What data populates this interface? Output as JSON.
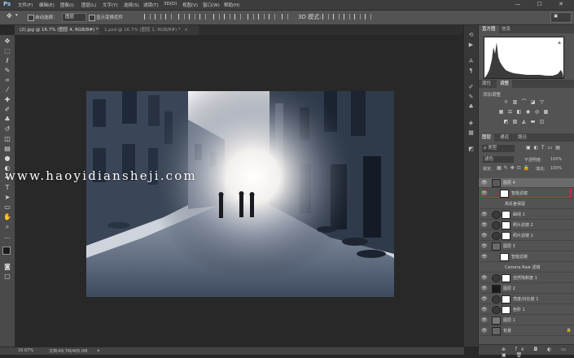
{
  "app": {
    "logo": "Ps"
  },
  "menu": [
    {
      "label": "文件(F)"
    },
    {
      "label": "编辑(E)"
    },
    {
      "label": "图像(I)"
    },
    {
      "label": "图层(L)"
    },
    {
      "label": "文字(Y)"
    },
    {
      "label": "选择(S)"
    },
    {
      "label": "滤镜(T)"
    },
    {
      "label": "3D(D)"
    },
    {
      "label": "视图(V)"
    },
    {
      "label": "窗口(W)"
    },
    {
      "label": "帮助(H)"
    }
  ],
  "window_controls": "— ☐ ✕",
  "options": {
    "auto_select_label": "自动选择：",
    "auto_select_target": "图层",
    "show_transform_label": "显示变换控件"
  },
  "documents": [
    {
      "title": "(2).jpg @ 16.7% (图层 4, RGB/8#) *"
    },
    {
      "title": "1.psd @ 16.7% (图层 1, RGB/8#) *"
    }
  ],
  "status": {
    "zoom": "16.67%",
    "doc_info": "文档:49.7M/405.0M"
  },
  "watermark": "www.haoyidiansheji.com",
  "panels": {
    "histogram_tabs": [
      "直方图",
      "信息"
    ],
    "props_tabs": [
      "属性",
      "调整"
    ],
    "adjust_label": "添加调整",
    "layers_tabs": [
      "图层",
      "通道",
      "路径"
    ],
    "layer_filter": "ρ 类型",
    "blend_mode": "滤色",
    "opacity_label": "不透明度:",
    "opacity_value": "100%",
    "lock_label": "锁定:",
    "fill_label": "填充:",
    "fill_value": "100%"
  },
  "layers": [
    {
      "name": "图层 4",
      "thumb": "#5a5a5a",
      "selected": true
    },
    {
      "name": "智能滤镜",
      "thumb": "#ffffff",
      "indent": true
    },
    {
      "name": "高反差保留",
      "thumb": "",
      "indent": true,
      "sub": true
    },
    {
      "name": "曲线 1",
      "thumb": "#ffffff",
      "adj": true
    },
    {
      "name": "照片滤镜 2",
      "thumb": "#ffffff",
      "adj": true
    },
    {
      "name": "照片滤镜 1",
      "thumb": "#ffffff",
      "adj": true
    },
    {
      "name": "图层 3",
      "thumb": "#6b6b6b"
    },
    {
      "name": "智能滤镜",
      "thumb": "#ffffff",
      "indent": true
    },
    {
      "name": "Camera Raw 滤镜",
      "thumb": "",
      "indent": true,
      "sub": true
    },
    {
      "name": "自然饱和度 1",
      "thumb": "#ffffff",
      "adj": true
    },
    {
      "name": "图层 2",
      "thumb": "#1a1a1a"
    },
    {
      "name": "亮度/对比度 1",
      "thumb": "#ffffff",
      "adj": true
    },
    {
      "name": "色阶 1",
      "thumb": "#ffffff",
      "adj": true
    },
    {
      "name": "图层 1",
      "thumb": "#777777"
    },
    {
      "name": "背景",
      "thumb": "#666666",
      "locked": true
    }
  ],
  "panel_footer": "⊕ fx ◘ ◐ ▭ ▣ 🗑",
  "colors": {
    "accent": "#d23030",
    "bg": "#282828",
    "panel": "#535353"
  }
}
